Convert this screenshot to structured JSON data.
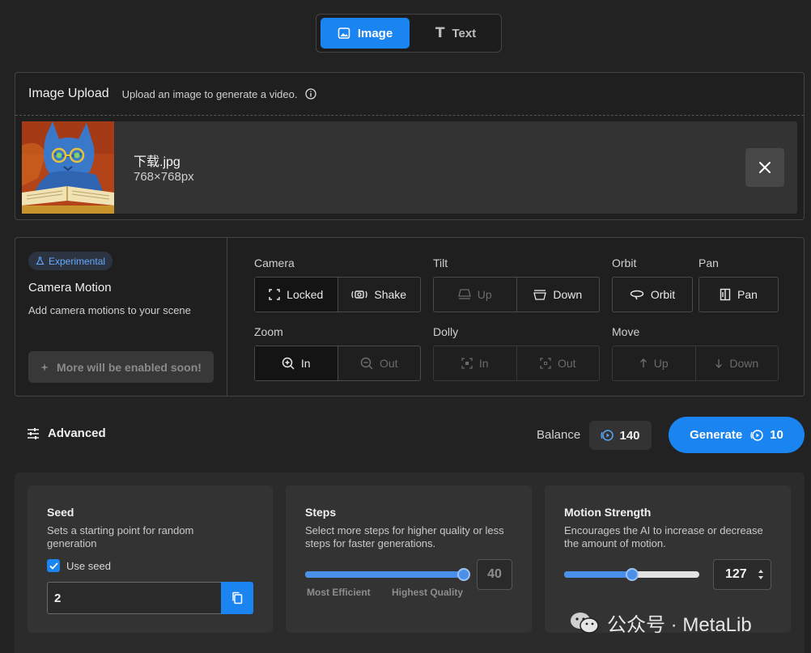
{
  "mode_toggle": {
    "image_label": "Image",
    "text_label": "Text",
    "active": "Image"
  },
  "upload": {
    "title": "Image Upload",
    "subtitle": "Upload an image to generate a video.",
    "file_name": "下载.jpg",
    "file_dims": "768×768px"
  },
  "camera": {
    "badge": "Experimental",
    "title": "Camera Motion",
    "subtitle": "Add camera motions to your scene",
    "more_label": "More will be enabled soon!",
    "groups": {
      "camera": {
        "label": "Camera",
        "options": [
          "Locked",
          "Shake"
        ],
        "selected": "Locked"
      },
      "tilt": {
        "label": "Tilt",
        "options": [
          "Up",
          "Down"
        ],
        "enabled": [
          "Down"
        ]
      },
      "orbit": {
        "label": "Orbit",
        "options": [
          "Orbit"
        ]
      },
      "pan": {
        "label": "Pan",
        "options": [
          "Pan"
        ]
      },
      "zoom": {
        "label": "Zoom",
        "options": [
          "In",
          "Out"
        ],
        "selected": "In"
      },
      "dolly": {
        "label": "Dolly",
        "options": [
          "In",
          "Out"
        ],
        "enabled": []
      },
      "move": {
        "label": "Move",
        "options": [
          "Up",
          "Down"
        ],
        "enabled": []
      }
    }
  },
  "actions": {
    "advanced_label": "Advanced",
    "balance_label": "Balance",
    "balance_value": "140",
    "generate_label": "Generate",
    "generate_cost": "10"
  },
  "settings": {
    "seed": {
      "title": "Seed",
      "description": "Sets a starting point for random generation",
      "use_seed_label": "Use seed",
      "use_seed_checked": true,
      "value": "2"
    },
    "steps": {
      "title": "Steps",
      "description": "Select more steps for higher quality or less steps for faster generations.",
      "min_label": "Most Efficient",
      "max_label": "Highest Quality",
      "value": "40",
      "fraction": 1.0
    },
    "motion": {
      "title": "Motion Strength",
      "description": "Encourages the AI to increase or decrease the amount of motion.",
      "value": "127",
      "fraction": 0.5
    }
  },
  "watermark": "公众号 · MetaLib",
  "colors": {
    "accent": "#1a84f0",
    "badge_text": "#62a9ff",
    "background": "#222222"
  }
}
